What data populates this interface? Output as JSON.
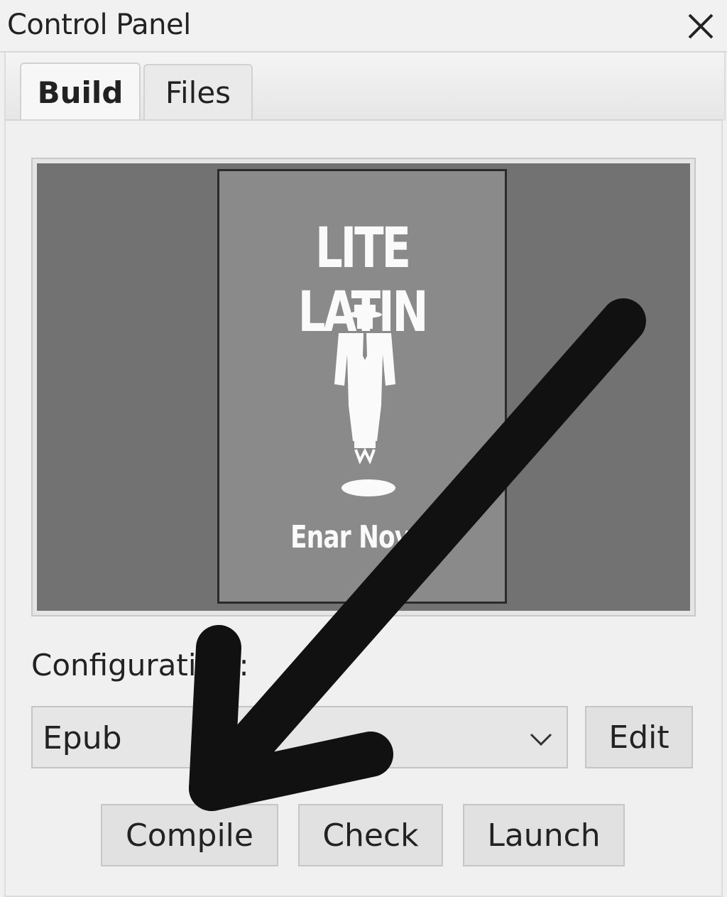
{
  "window": {
    "title": "Control Panel",
    "close_icon": "close-icon"
  },
  "tabs": [
    {
      "label": "Build",
      "selected": true
    },
    {
      "label": "Files",
      "selected": false
    }
  ],
  "preview": {
    "cover_title": "LITE LATIN",
    "cover_author": "Enar Novel",
    "cover_figure_icon": "man-in-suit-icon"
  },
  "config": {
    "label": "Configurati",
    "label_tail": ":",
    "selected_value": "Epub",
    "chevron_icon": "chevron-down-icon",
    "edit_label": "Edit"
  },
  "actions": {
    "compile_label": "Compile",
    "check_label": "Check",
    "launch_label": "Launch"
  },
  "annotation": {
    "icon": "arrow-annotation-icon",
    "color": "#111111"
  }
}
